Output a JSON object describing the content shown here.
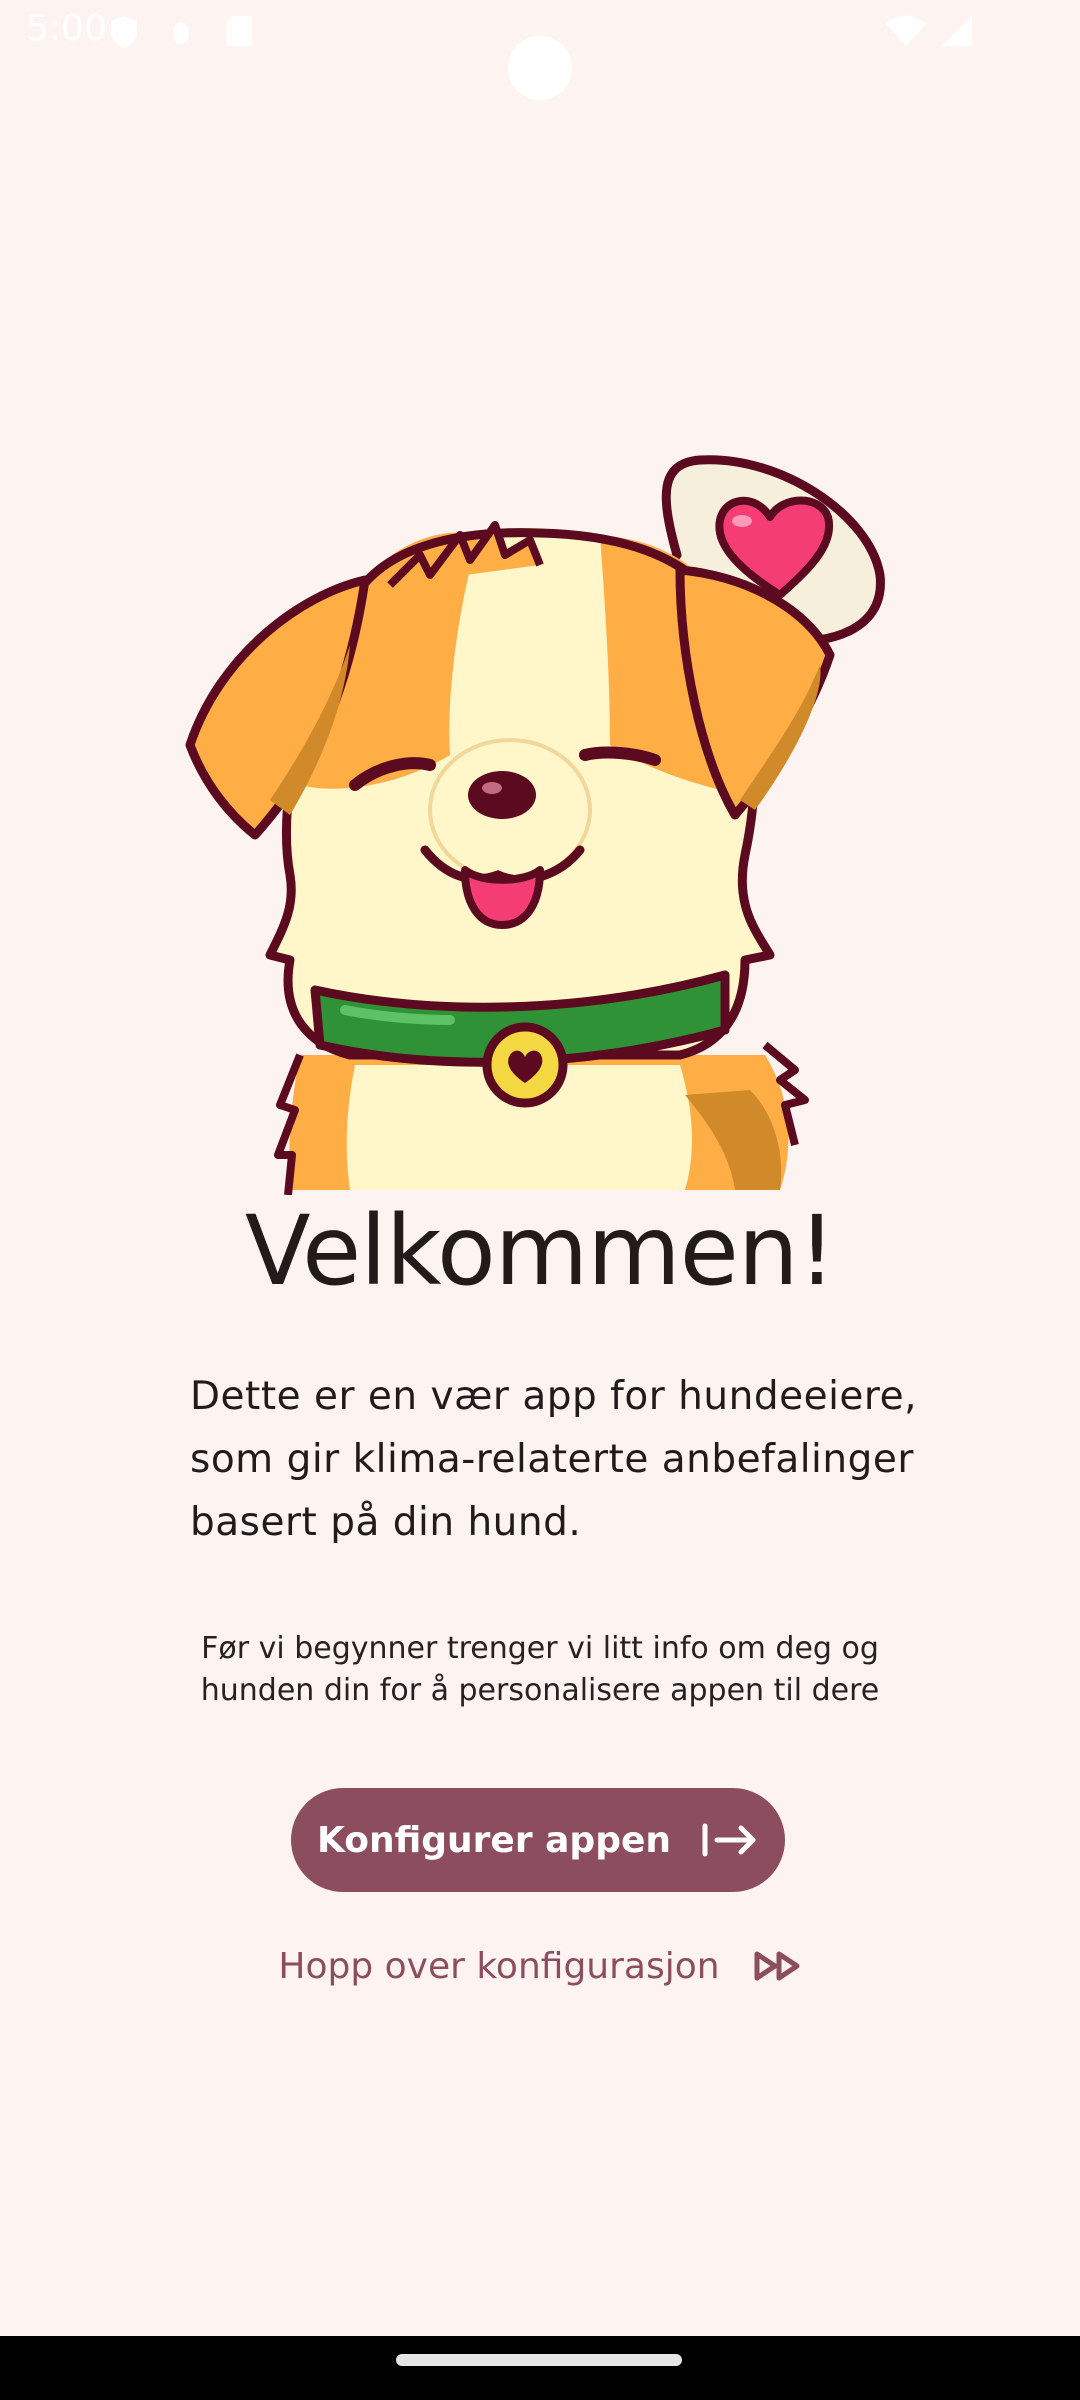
{
  "status_bar": {
    "time": "5:00",
    "icons": [
      "shield-icon",
      "bug-icon",
      "sd-card-icon",
      "wifi-icon",
      "signal-icon"
    ]
  },
  "welcome": {
    "title": "Velkommen!",
    "description": "Dette er en vær app for hundeeiere, som gir klima-relaterte anbefalinger basert på din hund.",
    "info": "Før vi begynner trenger vi litt info om deg og hunden din for å personalisere appen til dere"
  },
  "actions": {
    "configure_label": "Konfigurer appen",
    "configure_icon": "login-arrow-icon",
    "skip_label": "Hopp over konfigurasjon",
    "skip_icon": "fast-forward-icon"
  },
  "colors": {
    "background": "#fdf4f2",
    "primary": "#8c4d5e",
    "text": "#231a1a"
  }
}
